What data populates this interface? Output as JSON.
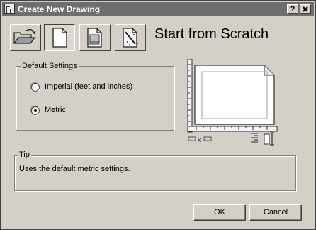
{
  "window": {
    "title": "Create New Drawing",
    "help_label": "?",
    "close_label": "x"
  },
  "tabs": [
    {
      "name": "open-drawing",
      "icon": "folder-open-icon"
    },
    {
      "name": "start-from-scratch",
      "icon": "blank-page-icon",
      "active": true
    },
    {
      "name": "use-template",
      "icon": "template-page-icon"
    },
    {
      "name": "use-wizard",
      "icon": "wizard-page-icon"
    }
  ],
  "heading": "Start from Scratch",
  "default_settings": {
    "label": "Default Settings",
    "options": [
      {
        "label": "Imperial (feet and inches)",
        "selected": false
      },
      {
        "label": "Metric",
        "selected": true
      }
    ]
  },
  "preview": {
    "icon": "drawing-preview-icon",
    "units_icon": "units-dimension-icon"
  },
  "tip": {
    "label": "Tip",
    "text": "Uses the default metric settings."
  },
  "buttons": {
    "ok": "OK",
    "cancel": "Cancel"
  }
}
